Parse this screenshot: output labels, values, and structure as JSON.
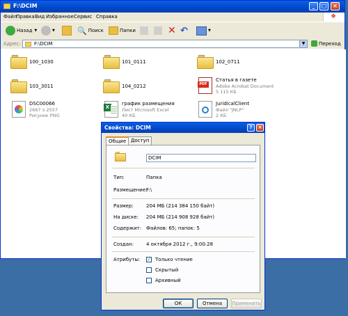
{
  "explorer": {
    "title": "F:\\DCIM",
    "menu": [
      "Файл",
      "Правка",
      "Вид",
      "Избранное",
      "Сервис",
      "Справка"
    ],
    "toolbar": {
      "back": "Назад",
      "search": "Поиск",
      "folders": "Папки"
    },
    "address_label": "Адрес:",
    "address_value": "F:\\DCIM",
    "go_label": "Переход",
    "items": [
      {
        "name": "100_1030",
        "kind": "folder"
      },
      {
        "name": "101_0111",
        "kind": "folder"
      },
      {
        "name": "102_0711",
        "kind": "folder"
      },
      {
        "name": "103_3011",
        "kind": "folder"
      },
      {
        "name": "104_0212",
        "kind": "folder"
      },
      {
        "name": "Статья в газете",
        "type": "Adobe Acrobat Document",
        "size": "5 115 КБ",
        "kind": "pdf"
      },
      {
        "name": "DSC00066",
        "type": "2667 x 2557",
        "size": "Рисунок PNG",
        "kind": "png"
      },
      {
        "name": "график размещения",
        "type": "Лист Microsoft Excel",
        "size": "40 КБ",
        "kind": "excel"
      },
      {
        "name": "JuridicalClient",
        "type": "Файл \"JNLP\"",
        "size": "2 КБ",
        "kind": "jnlp"
      }
    ]
  },
  "dialog": {
    "title": "Свойства: DCIM",
    "tabs": [
      "Общие",
      "Доступ"
    ],
    "folder_name": "DCIM",
    "fields": {
      "type_label": "Тип:",
      "type_value": "Папка",
      "location_label": "Размещение:",
      "location_value": "F:\\",
      "size_label": "Размер:",
      "size_value": "204 МБ (214 384 150 байт)",
      "disk_label": "На диске:",
      "disk_value": "204 МБ (214 908 928 байт)",
      "contains_label": "Содержит:",
      "contains_value": "Файлов: 65; папок: 5",
      "created_label": "Создан:",
      "created_value": "4 октября 2012 г., 9:00:28",
      "attributes_label": "Атрибуты:"
    },
    "attributes": [
      {
        "label": "Только чтение",
        "checked": true
      },
      {
        "label": "Скрытый",
        "checked": false
      },
      {
        "label": "Архивный",
        "checked": false
      }
    ],
    "buttons": {
      "ok": "ОК",
      "cancel": "Отмена",
      "apply": "Применить"
    }
  }
}
